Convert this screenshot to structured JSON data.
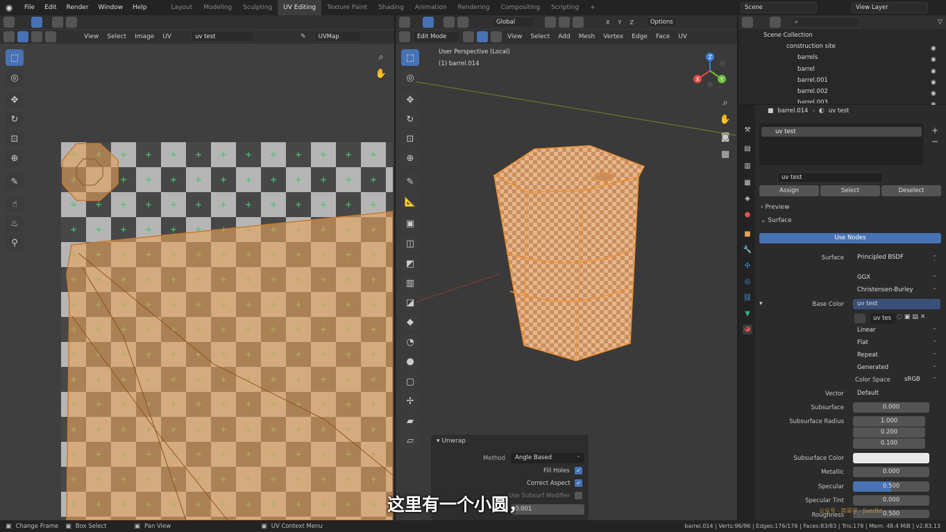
{
  "topbar": {
    "menus": [
      "File",
      "Edit",
      "Render",
      "Window",
      "Help"
    ],
    "workspaces": [
      "Layout",
      "Modeling",
      "Sculpting",
      "UV Editing",
      "Texture Paint",
      "Shading",
      "Animation",
      "Rendering",
      "Compositing",
      "Scripting"
    ],
    "active_workspace": "UV Editing",
    "add_tab": "+",
    "scene": "Scene",
    "view_layer": "View Layer"
  },
  "uv_editor": {
    "menus": [
      "View",
      "Select",
      "Image",
      "UV"
    ],
    "image_name": "uv test",
    "uvmap": "UVMap"
  },
  "viewport": {
    "mode": "Edit Mode",
    "orientation": "Global",
    "menus": [
      "View",
      "Select",
      "Add",
      "Mesh",
      "Vertex",
      "Edge",
      "Face",
      "UV"
    ],
    "options": "Options",
    "perspective_label": "User Perspective (Local)",
    "object_label": "(1) barrel.014",
    "gizmo_axes": [
      "Z",
      "Y",
      "X"
    ]
  },
  "unwrap_panel": {
    "title": "Unwrap",
    "method_label": "Method",
    "method_value": "Angle Based",
    "fill_holes": "Fill Holes",
    "correct_aspect": "Correct Aspect",
    "subsurf": "Use Subsurf Modifier",
    "margin_value": "0.001"
  },
  "subtitle": "这里有一个小圆，",
  "outliner": {
    "root": "Scene Collection",
    "items": [
      "construction site",
      "barrels",
      "barrel",
      "barrel.001",
      "barrel.002",
      "barrel.003"
    ]
  },
  "properties": {
    "object": "barrel.014",
    "material": "uv test",
    "slot": "uv test",
    "material_field": "uv test",
    "assign": "Assign",
    "select": "Select",
    "deselect": "Deselect",
    "preview": "Preview",
    "surface_section": "Surface",
    "use_nodes": "Use Nodes",
    "rows": [
      {
        "label": "Surface",
        "value": "Principled BSDF"
      },
      {
        "label": "",
        "value": "GGX"
      },
      {
        "label": "",
        "value": "Christensen-Burley"
      },
      {
        "label": "Base Color",
        "value": "uv test"
      },
      {
        "label": "",
        "value": "uv tes"
      },
      {
        "label": "",
        "value": "Linear"
      },
      {
        "label": "",
        "value": "Flat"
      },
      {
        "label": "",
        "value": "Repeat"
      },
      {
        "label": "",
        "value": "Generated"
      },
      {
        "label": "Color Space",
        "value": "sRGB"
      },
      {
        "label": "Vector",
        "value": "Default"
      },
      {
        "label": "Subsurface",
        "value": "0.000"
      },
      {
        "label": "Subsurface Radius",
        "value": "1.000"
      },
      {
        "label": "",
        "value": "0.200"
      },
      {
        "label": "",
        "value": "0.100"
      },
      {
        "label": "Subsurface Color",
        "value": ""
      },
      {
        "label": "Metallic",
        "value": "0.000"
      },
      {
        "label": "Specular",
        "value": "0.500"
      },
      {
        "label": "Specular Tint",
        "value": "0.000"
      },
      {
        "label": "Roughness",
        "value": "0.500"
      }
    ],
    "watermark": "公众号 · 简哥学 · JixerBd"
  },
  "statusbar": {
    "left": [
      "Change Frame",
      "Box Select",
      "Pan View",
      "UV Context Menu"
    ],
    "right": "barrel.014 | Verts:96/96 | Edges:176/176 | Faces:83/83 | Tris:178 | Mem: 48.4 MiB | v2.83.13"
  },
  "colors": {
    "accent": "#4772b3",
    "uv_orange": "#e8a35c",
    "panel": "#2b2b2b"
  }
}
